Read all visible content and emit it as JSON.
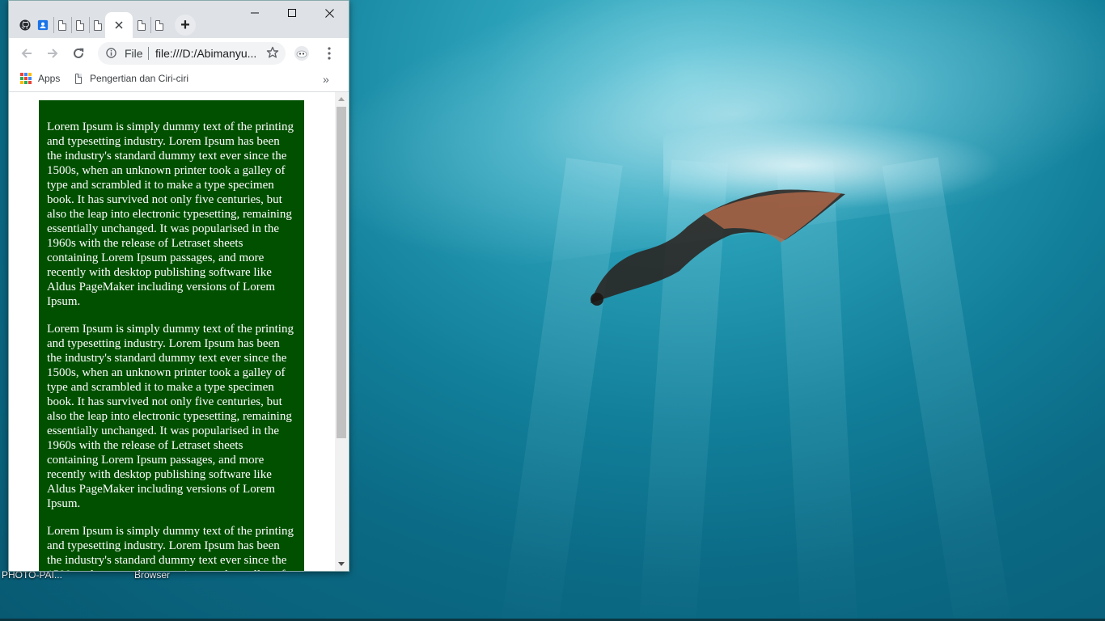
{
  "desktop": {
    "icon_labels": [
      "PHOTO-PAI...",
      "Browser"
    ]
  },
  "browser": {
    "tabs": [
      {
        "icon": "github-icon",
        "pinned": true
      },
      {
        "icon": "contacts-icon",
        "pinned": true
      },
      {
        "icon": "page-icon",
        "pinned": true
      },
      {
        "icon": "page-icon",
        "pinned": true
      },
      {
        "icon": "page-icon",
        "pinned": true
      },
      {
        "icon": "close-icon",
        "active": true
      },
      {
        "icon": "page-icon",
        "pinned": true
      },
      {
        "icon": "page-icon",
        "pinned": true
      }
    ],
    "new_tab_label": "+",
    "omnibox": {
      "scheme_label": "File",
      "url": "file:///D:/Abimanyu..."
    },
    "bookmarks": {
      "apps_label": "Apps",
      "page_label": "Pengertian dan Ciri-ciri",
      "overflow_label": "»"
    },
    "content": {
      "paragraphs": [
        "Lorem Ipsum is simply dummy text of the printing and typesetting industry. Lorem Ipsum has been the industry's standard dummy text ever since the 1500s, when an unknown printer took a galley of type and scrambled it to make a type specimen book. It has survived not only five centuries, but also the leap into electronic typesetting, remaining essentially unchanged. It was popularised in the 1960s with the release of Letraset sheets containing Lorem Ipsum passages, and more recently with desktop publishing software like Aldus PageMaker including versions of Lorem Ipsum.",
        "Lorem Ipsum is simply dummy text of the printing and typesetting industry. Lorem Ipsum has been the industry's standard dummy text ever since the 1500s, when an unknown printer took a galley of type and scrambled it to make a type specimen book. It has survived not only five centuries, but also the leap into electronic typesetting, remaining essentially unchanged. It was popularised in the 1960s with the release of Letraset sheets containing Lorem Ipsum passages, and more recently with desktop publishing software like Aldus PageMaker including versions of Lorem Ipsum.",
        "Lorem Ipsum is simply dummy text of the printing and typesetting industry. Lorem Ipsum has been the industry's standard dummy text ever since the 1500s, when an unknown printer took a galley of type and scrambled it to make a type specimen book."
      ],
      "box_color": "#005000",
      "text_color": "#ffffff"
    }
  }
}
